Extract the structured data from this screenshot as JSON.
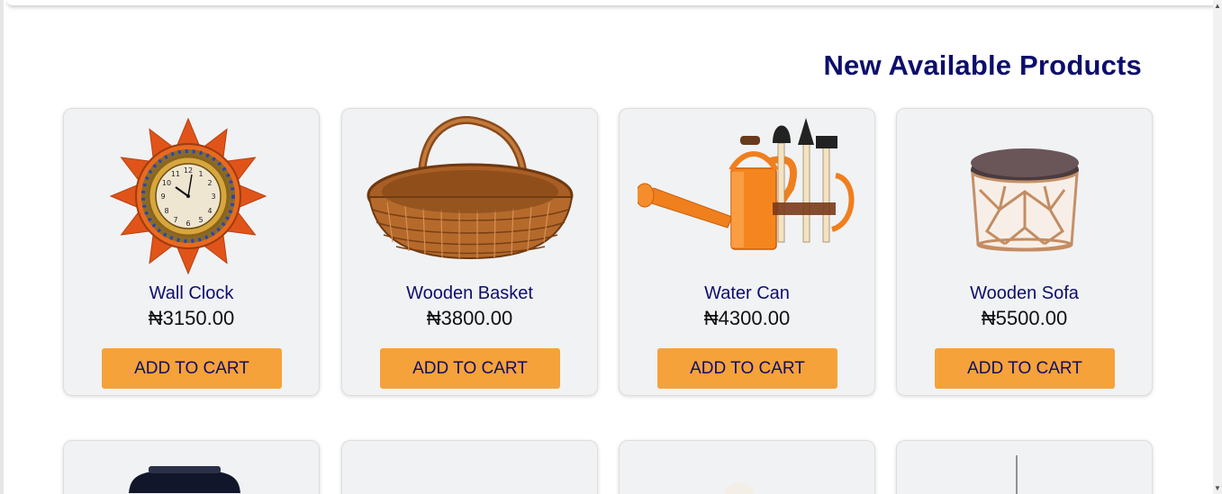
{
  "section": {
    "title": "New Available Products"
  },
  "products": [
    {
      "name": "Wall Clock",
      "price": "₦3150.00",
      "button": "ADD TO CART",
      "icon": "wall-clock-image"
    },
    {
      "name": "Wooden Basket",
      "price": "₦3800.00",
      "button": "ADD TO CART",
      "icon": "wooden-basket-image"
    },
    {
      "name": "Water Can",
      "price": "₦4300.00",
      "button": "ADD TO CART",
      "icon": "water-can-image"
    },
    {
      "name": "Wooden Sofa",
      "price": "₦5500.00",
      "button": "ADD TO CART",
      "icon": "wooden-sofa-image"
    }
  ],
  "colors": {
    "accent": "#f6a23a",
    "title": "#0d0e6b",
    "card_bg": "#f1f2f4"
  }
}
